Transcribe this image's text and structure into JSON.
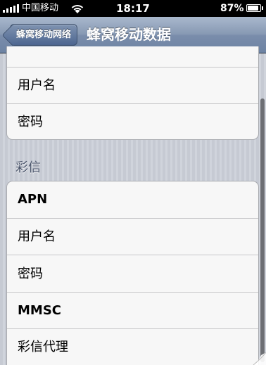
{
  "status_bar": {
    "carrier": "中国移动",
    "time": "18:17",
    "battery_percent": "87%",
    "battery_level": 0.87,
    "signal_bars": 5,
    "wifi_icon": "wifi-icon"
  },
  "nav": {
    "back_label": "蜂窝移动网络",
    "title": "蜂窝移动数据"
  },
  "group1": {
    "rows": [
      "",
      "用户名",
      "密码"
    ]
  },
  "mms_section": {
    "header": "彩信",
    "rows": [
      "APN",
      "用户名",
      "密码",
      "MMSC",
      "彩信代理"
    ]
  },
  "colors": {
    "nav_gradient_top": "#a9b8cd",
    "nav_gradient_bottom": "#6d83a3",
    "section_header": "#4c566c",
    "background": "#c8ccd4"
  }
}
